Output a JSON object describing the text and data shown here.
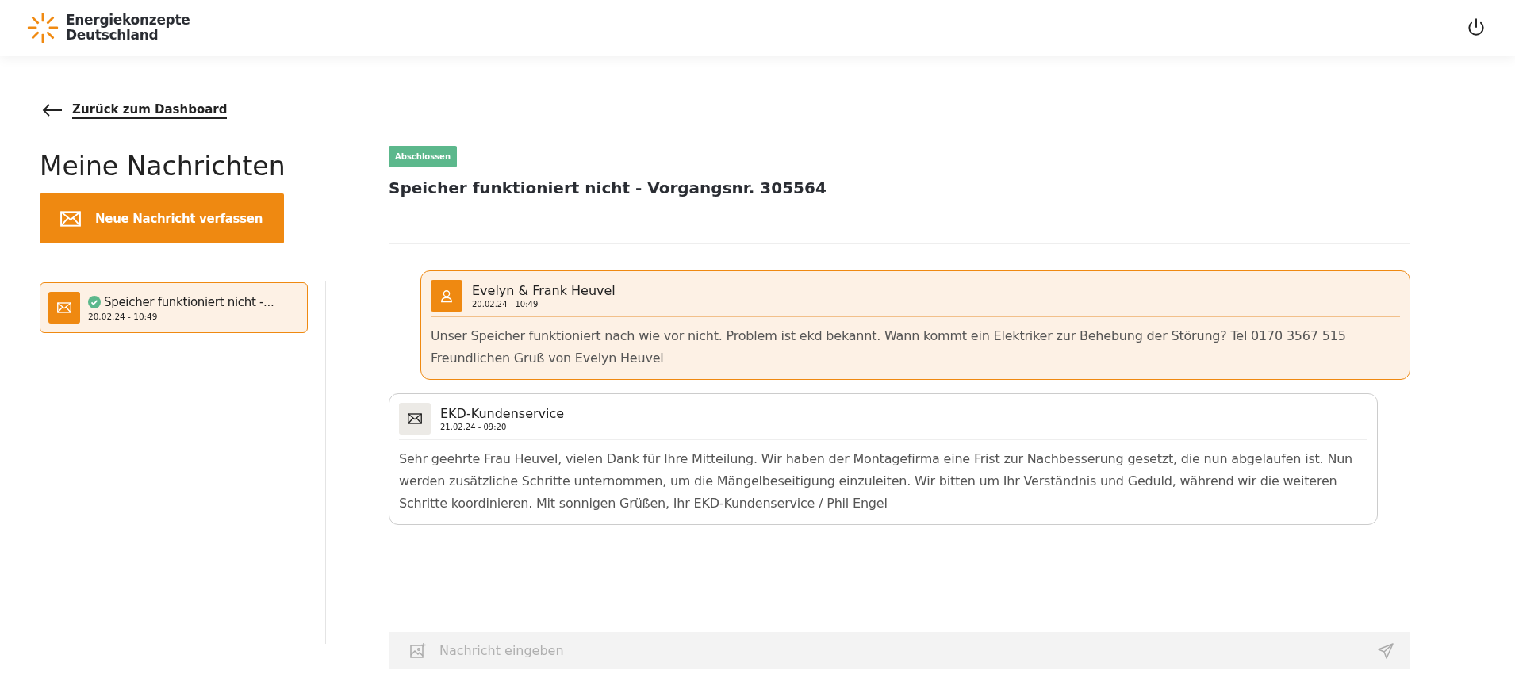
{
  "header": {
    "brand_line_1": "Energiekonzepte",
    "brand_line_2": "Deutschland"
  },
  "back_link": "Zurück zum Dashboard",
  "sidebar": {
    "title": "Meine Nachrichten",
    "new_button": "Neue Nachricht verfassen",
    "items": [
      {
        "title": "Speicher funktioniert nicht -...",
        "date": "20.02.24 - 10:49",
        "resolved": true,
        "selected": true
      }
    ]
  },
  "conversation": {
    "status": "Abschlossen",
    "title": "Speicher funktioniert nicht - Vorgangsnr. 305564",
    "messages": [
      {
        "kind": "customer",
        "sender": "Evelyn & Frank Heuvel",
        "date": "20.02.24 - 10:49",
        "text": "Unser Speicher funktioniert nach wie vor nicht. Problem ist ekd bekannt. Wann kommt ein Elektriker zur Behebung der Störung? Tel 0170 3567 515 Freundlichen Gruß von Evelyn Heuvel"
      },
      {
        "kind": "service",
        "sender": "EKD-Kundenservice",
        "date": "21.02.24 - 09:20",
        "text": "Sehr geehrte Frau Heuvel, vielen Dank für Ihre Mitteilung. Wir haben der Montagefirma eine Frist zur Nachbesserung gesetzt, die nun abgelaufen ist. Nun werden zusätzliche Schritte unternommen, um die Mängelbeseitigung einzuleiten. Wir bitten um Ihr Verständnis und Geduld, während wir die weiteren Schritte koordinieren. Mit sonnigen Grüßen, Ihr EKD-Kundenservice / Phil Engel"
      }
    ],
    "input": {
      "placeholder": "Nachricht eingeben"
    }
  }
}
